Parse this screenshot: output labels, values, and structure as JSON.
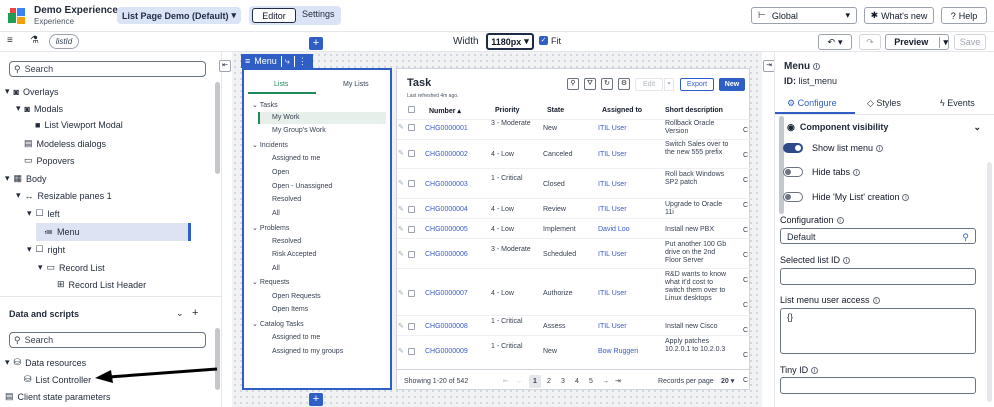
{
  "app": {
    "title": "Demo Experience",
    "subtitle": "Experience",
    "page_select": "List Page Demo (Default)",
    "tab_editor": "Editor",
    "tab_settings": "Settings",
    "scope": "Global",
    "whats_new": "What's new",
    "help": "Help"
  },
  "toolbar": {
    "param_chip": "listId",
    "width_label": "Width",
    "width_value": "1180px",
    "fit_label": "Fit",
    "preview": "Preview",
    "save": "Save"
  },
  "tree": {
    "search_placeholder": "Search",
    "items": [
      {
        "label": "Overlays"
      },
      {
        "label": "Modals"
      },
      {
        "label": "List Viewport Modal"
      },
      {
        "label": "Modeless dialogs"
      },
      {
        "label": "Popovers"
      },
      {
        "label": "Body"
      },
      {
        "label": "Resizable panes 1"
      },
      {
        "label": "left"
      },
      {
        "label": "Menu"
      },
      {
        "label": "right"
      },
      {
        "label": "Record List"
      },
      {
        "label": "Record List Header"
      }
    ]
  },
  "data_scripts": {
    "title": "Data and scripts",
    "search_placeholder": "Search",
    "items": [
      {
        "label": "Data resources"
      },
      {
        "label": "List Controller"
      },
      {
        "label": "Client state parameters"
      }
    ]
  },
  "canvas": {
    "menu_tab": "Menu"
  },
  "list_menu": {
    "tab_lists": "Lists",
    "tab_my_lists": "My Lists",
    "groups": [
      {
        "label": "Tasks",
        "items": [
          "My Work",
          "My Group's Work"
        ]
      },
      {
        "label": "Incidents",
        "items": [
          "Assigned to me",
          "Open",
          "Open - Unassigned",
          "Resolved",
          "All"
        ]
      },
      {
        "label": "Problems",
        "items": [
          "Resolved",
          "Risk Accepted",
          "All"
        ]
      },
      {
        "label": "Requests",
        "items": [
          "Open Requests",
          "Open Items"
        ]
      },
      {
        "label": "Catalog Tasks",
        "items": [
          "Assigned to me",
          "Assigned to my groups"
        ]
      }
    ]
  },
  "task_table": {
    "title": "Task",
    "refreshed": "Last refreshed 4m ago.",
    "edit": "Edit",
    "export": "Export",
    "new": "New",
    "columns": [
      "Number",
      "Priority",
      "State",
      "Assigned to",
      "Short description"
    ],
    "rows": [
      {
        "number": "CHG0000001",
        "priority": "3 - Moderate",
        "state": "New",
        "assigned": "ITIL User",
        "desc": "Rollback Oracle Version"
      },
      {
        "number": "CHG0000002",
        "priority": "4 - Low",
        "state": "Canceled",
        "assigned": "ITIL User",
        "desc": "Switch Sales over to the new 555 prefix"
      },
      {
        "number": "CHG0000003",
        "priority": "1 - Critical",
        "state": "Closed",
        "assigned": "ITIL User",
        "desc": "Roll back Windows SP2 patch"
      },
      {
        "number": "CHG0000004",
        "priority": "4 - Low",
        "state": "Review",
        "assigned": "ITIL User",
        "desc": "Upgrade to Oracle 11i"
      },
      {
        "number": "CHG0000005",
        "priority": "4 - Low",
        "state": "Implement",
        "assigned": "David Loo",
        "desc": "Install new PBX"
      },
      {
        "number": "CHG0000006",
        "priority": "3 - Moderate",
        "state": "Scheduled",
        "assigned": "ITIL User",
        "desc": "Put another 100 Gb drive on the 2nd Floor Server"
      },
      {
        "number": "CHG0000007",
        "priority": "4 - Low",
        "state": "Authorize",
        "assigned": "ITIL User",
        "desc": "R&D wants to know what it'd cost to switch them over to Linux desktops"
      },
      {
        "number": "CHG0000008",
        "priority": "1 - Critical",
        "state": "Assess",
        "assigned": "ITIL User",
        "desc": "Install new Cisco"
      },
      {
        "number": "CHG0000009",
        "priority": "1 - Critical",
        "state": "New",
        "assigned": "Bow Ruggeri",
        "desc": "Apply patches 10.2.0.1 to 10.2.0.3"
      }
    ],
    "footer_showing": "Showing 1-20 of 542",
    "pages": [
      "1",
      "2",
      "3",
      "4",
      "5"
    ],
    "records_label": "Records per page",
    "records_value": "20"
  },
  "props": {
    "title": "Menu",
    "id_label": "ID: list_menu",
    "tab_configure": "Configure",
    "tab_styles": "Styles",
    "tab_events": "Events",
    "section": "Component visibility",
    "show_list_menu": "Show list menu",
    "hide_tabs": "Hide tabs",
    "hide_my_list": "Hide 'My List' creation",
    "configuration_label": "Configuration",
    "configuration_value": "Default",
    "selected_list_label": "Selected list ID",
    "access_label": "List menu user access",
    "access_value": "{}",
    "tiny_label": "Tiny ID"
  }
}
